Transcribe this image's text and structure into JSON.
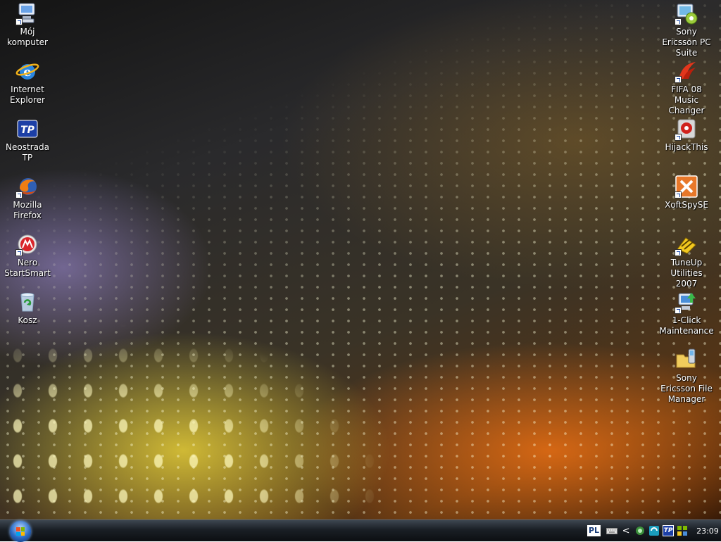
{
  "desktop": {
    "left_icons": [
      {
        "label": "Mój komputer",
        "icon": "computer-icon"
      },
      {
        "label": "Internet Explorer",
        "icon": "internet-explorer-icon"
      },
      {
        "label": "Neostrada TP",
        "icon": "neostrada-tp-icon"
      },
      {
        "label": "Mozilla Firefox",
        "icon": "firefox-icon"
      },
      {
        "label": "Nero StartSmart",
        "icon": "nero-icon"
      },
      {
        "label": "Kosz",
        "icon": "recycle-bin-icon"
      }
    ],
    "right_icons": [
      {
        "label": "Sony Ericsson PC Suite",
        "icon": "pc-suite-icon"
      },
      {
        "label": "FIFA 08 Music Changer",
        "icon": "fifa-music-changer-icon"
      },
      {
        "label": "HijackThis",
        "icon": "hijackthis-icon"
      },
      {
        "label": "XoftSpySE",
        "icon": "xoftspy-icon"
      },
      {
        "label": "TuneUp Utilities 2007",
        "icon": "tuneup-icon"
      },
      {
        "label": "1-Click Maintenance",
        "icon": "one-click-maintenance-icon"
      },
      {
        "label": "Sony Ericsson File Manager",
        "icon": "file-manager-icon"
      }
    ]
  },
  "taskbar": {
    "language": "PL",
    "expand_tray": "<",
    "tp_label": "TP",
    "clock": "23:09"
  },
  "colors": {
    "taskbar": "#1a1f25",
    "accent": "#2a6bc5"
  }
}
